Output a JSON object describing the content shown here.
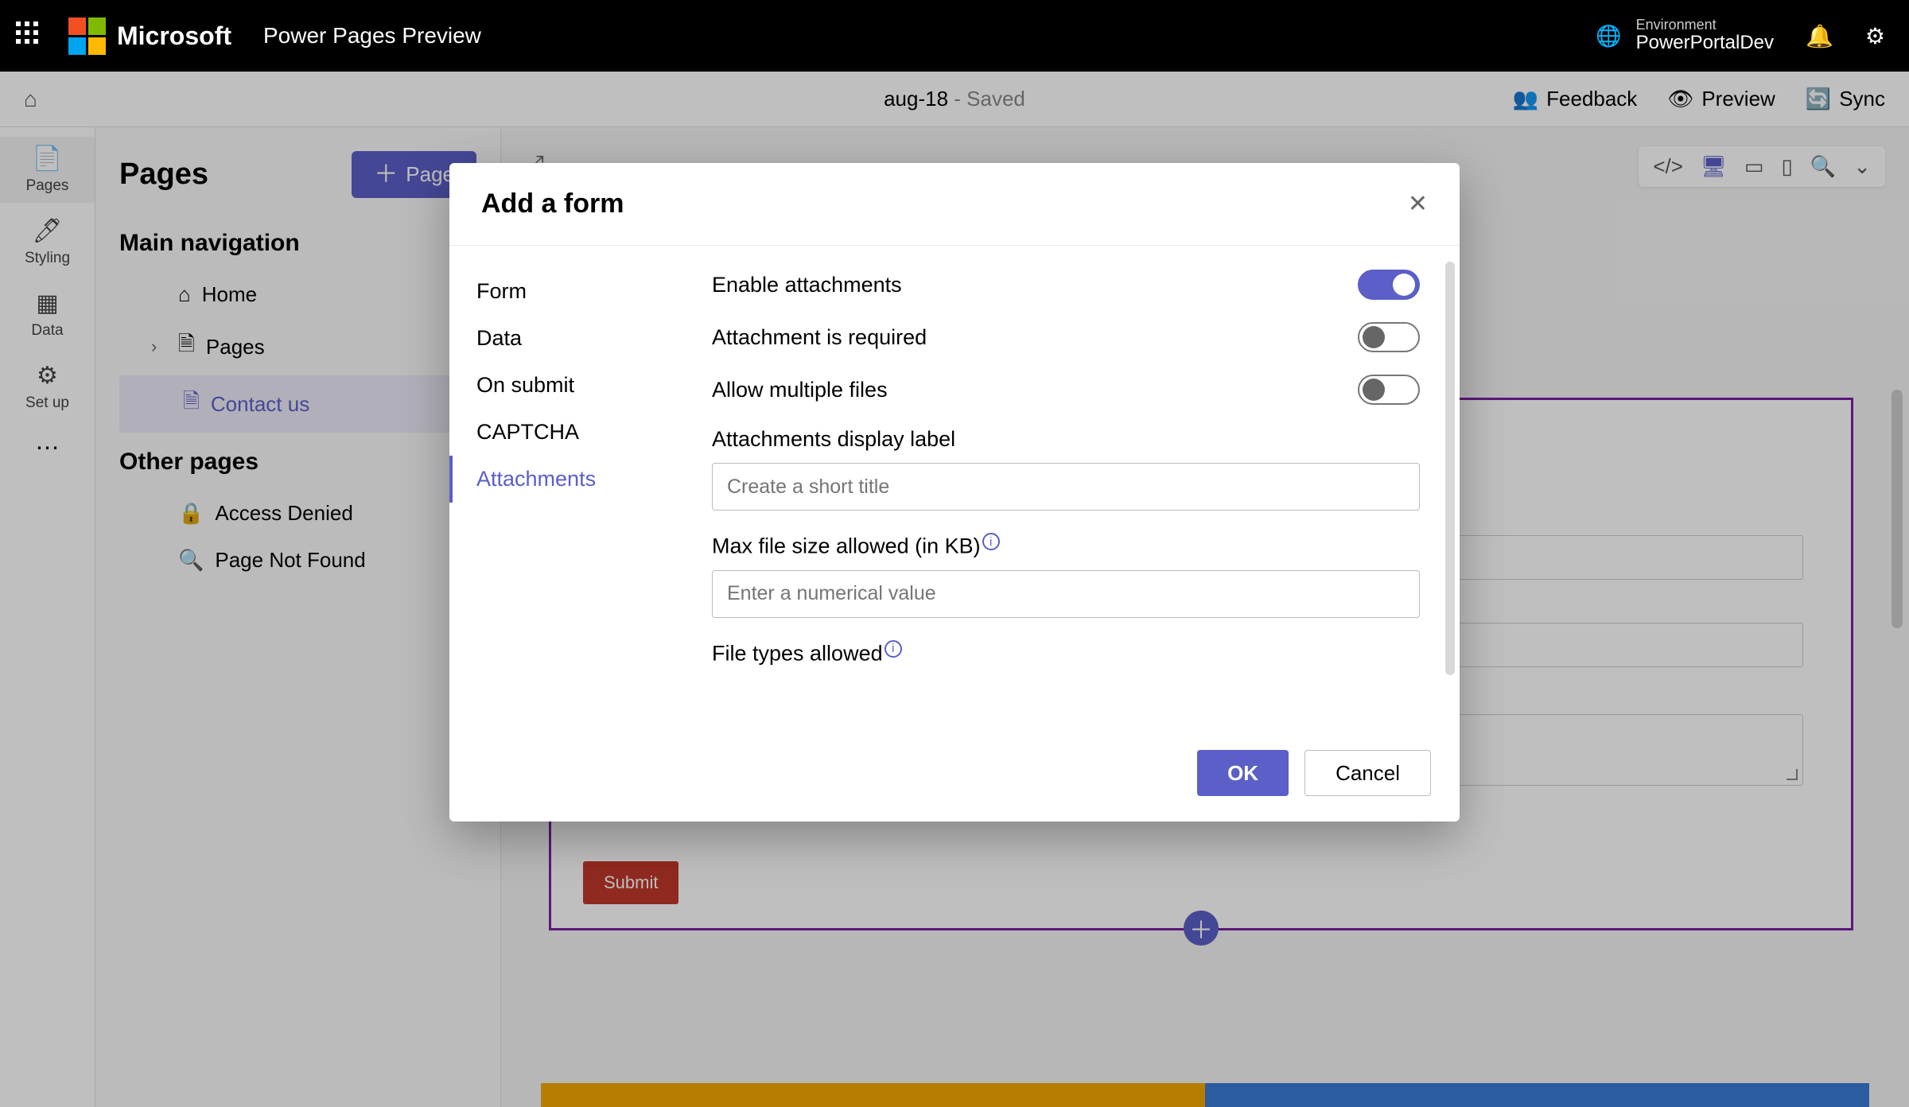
{
  "topbar": {
    "brand": "Microsoft",
    "product": "Power Pages Preview",
    "env_label": "Environment",
    "env_name": "PowerPortalDev"
  },
  "cmdbar": {
    "doc_name": "aug-18",
    "status_separator": " - ",
    "status": "Saved",
    "feedback": "Feedback",
    "preview": "Preview",
    "sync": "Sync"
  },
  "rail": {
    "pages": "Pages",
    "styling": "Styling",
    "data": "Data",
    "setup": "Set up"
  },
  "sidepanel": {
    "title": "Pages",
    "add_button": "Page",
    "main_nav": "Main navigation",
    "home": "Home",
    "pages": "Pages",
    "contact": "Contact us",
    "other_pages": "Other pages",
    "access_denied": "Access Denied",
    "not_found": "Page Not Found"
  },
  "canvas": {
    "submit": "Submit"
  },
  "dialog": {
    "title": "Add a form",
    "tabs": {
      "form": "Form",
      "data": "Data",
      "onsubmit": "On submit",
      "captcha": "CAPTCHA",
      "attachments": "Attachments"
    },
    "fields": {
      "enable": "Enable attachments",
      "required": "Attachment is required",
      "multiple": "Allow multiple files",
      "display_label": "Attachments display label",
      "display_placeholder": "Create a short title",
      "maxsize": "Max file size allowed (in KB)",
      "maxsize_placeholder": "Enter a numerical value",
      "filetypes": "File types allowed"
    },
    "ok": "OK",
    "cancel": "Cancel"
  }
}
